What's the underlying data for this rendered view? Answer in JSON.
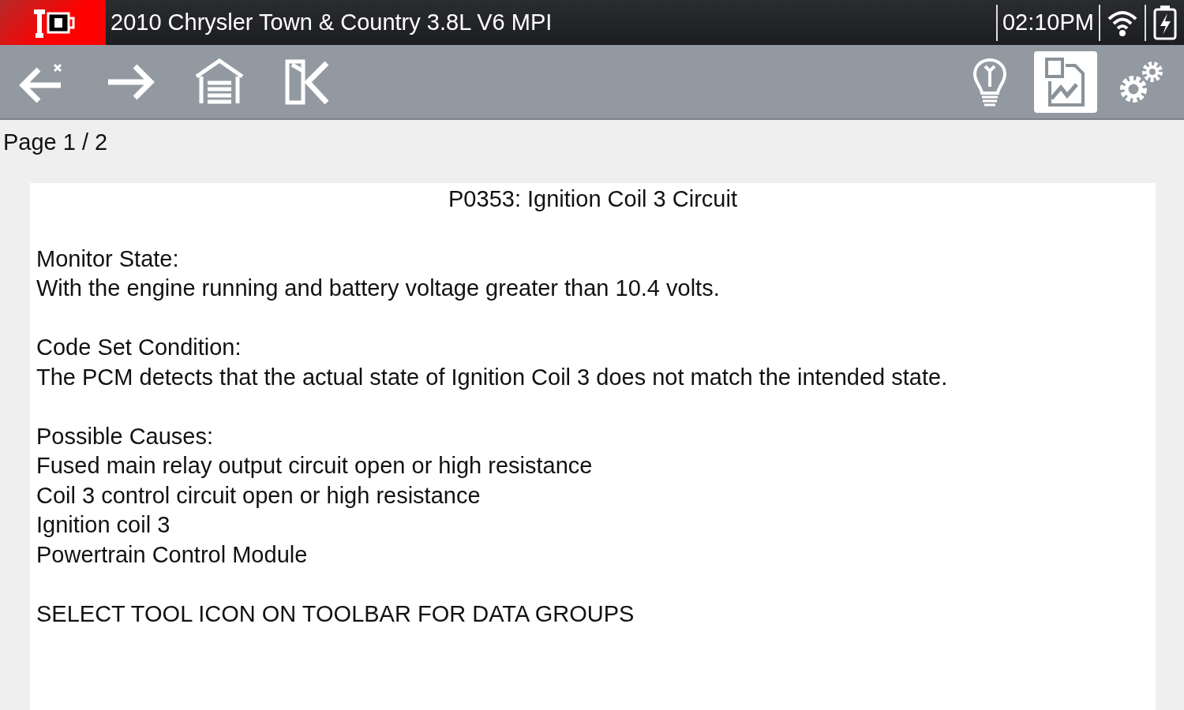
{
  "status_bar": {
    "title": "2010 Chrysler Town & Country 3.8L V6 MPI",
    "time": "02:10PM"
  },
  "toolbar": {
    "left": [
      {
        "kind": "back",
        "selected": false
      },
      {
        "kind": "forward",
        "selected": false
      },
      {
        "kind": "home",
        "selected": false
      },
      {
        "kind": "exit",
        "selected": false
      }
    ],
    "right": [
      {
        "kind": "tips",
        "selected": false
      },
      {
        "kind": "save",
        "selected": true
      },
      {
        "kind": "settings",
        "selected": false
      }
    ]
  },
  "page_indicator": "Page 1 / 2",
  "document": {
    "title": "P0353: Ignition Coil 3 Circuit",
    "sections": [
      {
        "heading": "Monitor State:",
        "lines": [
          "With the engine running and battery voltage greater than 10.4 volts."
        ]
      },
      {
        "heading": "Code Set Condition:",
        "lines": [
          "The PCM detects that the actual state of Ignition Coil 3 does not match the intended state."
        ]
      },
      {
        "heading": "Possible Causes:",
        "lines": [
          "Fused main relay output circuit open or high resistance",
          "Coil 3 control circuit open or high resistance",
          "Ignition coil 3",
          "Powertrain Control Module"
        ]
      }
    ],
    "note": "SELECT TOOL ICON ON TOOLBAR FOR DATA GROUPS"
  }
}
